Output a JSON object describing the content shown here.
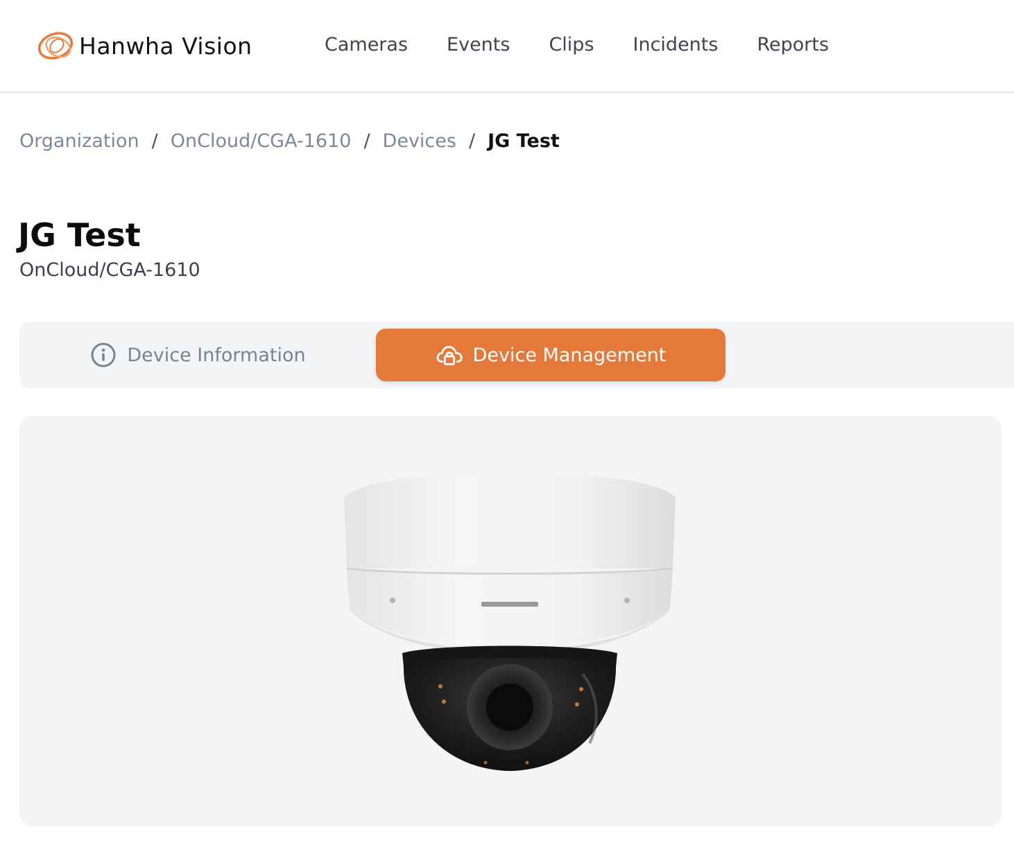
{
  "header": {
    "logo_text": "Hanwha Vision",
    "nav": [
      {
        "label": "Cameras"
      },
      {
        "label": "Events"
      },
      {
        "label": "Clips"
      },
      {
        "label": "Incidents"
      },
      {
        "label": "Reports"
      }
    ]
  },
  "breadcrumb": {
    "items": [
      "Organization",
      "OnCloud/CGA-1610",
      "Devices"
    ],
    "separator": "/",
    "current": "JG Test"
  },
  "page": {
    "title": "JG Test",
    "subtitle": "OnCloud/CGA-1610"
  },
  "tabs": [
    {
      "label": "Device Information",
      "icon": "info-icon",
      "active": false
    },
    {
      "label": "Device Management",
      "icon": "cloud-lock-icon",
      "active": true
    }
  ],
  "colors": {
    "accent": "#e5793a",
    "nav_text": "#3f4350",
    "breadcrumb_link": "#7e8798",
    "panel_bg": "#f3f4f6"
  }
}
